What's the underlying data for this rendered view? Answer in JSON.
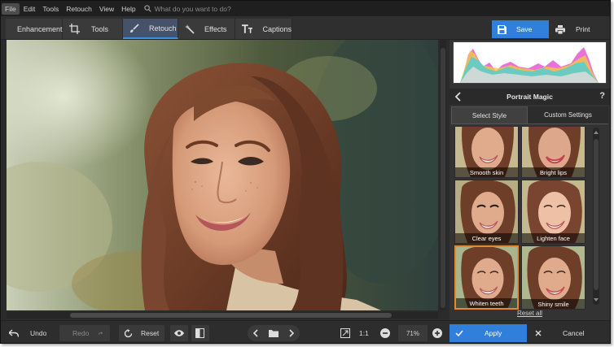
{
  "menubar": {
    "items": [
      "File",
      "Edit",
      "Tools",
      "Retouch",
      "View",
      "Help"
    ],
    "search_placeholder": "What do you want to do?"
  },
  "toolbar": {
    "tabs": [
      "Enhancement",
      "Tools",
      "Retouch",
      "Effects",
      "Captions"
    ],
    "active_tab": "Retouch",
    "save_label": "Save",
    "print_label": "Print"
  },
  "panel": {
    "title": "Portrait Magic",
    "help_label": "?",
    "tabs": [
      "Select Style",
      "Custom Settings"
    ],
    "active_tab": "Select Style",
    "styles": [
      "Smooth skin",
      "Bright lips",
      "Clear eyes",
      "Lighten face",
      "Whiten teeth",
      "Shiny smile"
    ],
    "selected_style": "Whiten teeth",
    "reset_all_label": "Reset all"
  },
  "bottombar": {
    "undo_label": "Undo",
    "redo_label": "Redo",
    "reset_label": "Reset",
    "ratio_label": "1:1",
    "zoom_value": "71%",
    "apply_label": "Apply",
    "cancel_label": "Cancel"
  },
  "colors": {
    "accent": "#2f7fdb",
    "selected_border": "#e5892a",
    "background": "#2b2b2b"
  }
}
